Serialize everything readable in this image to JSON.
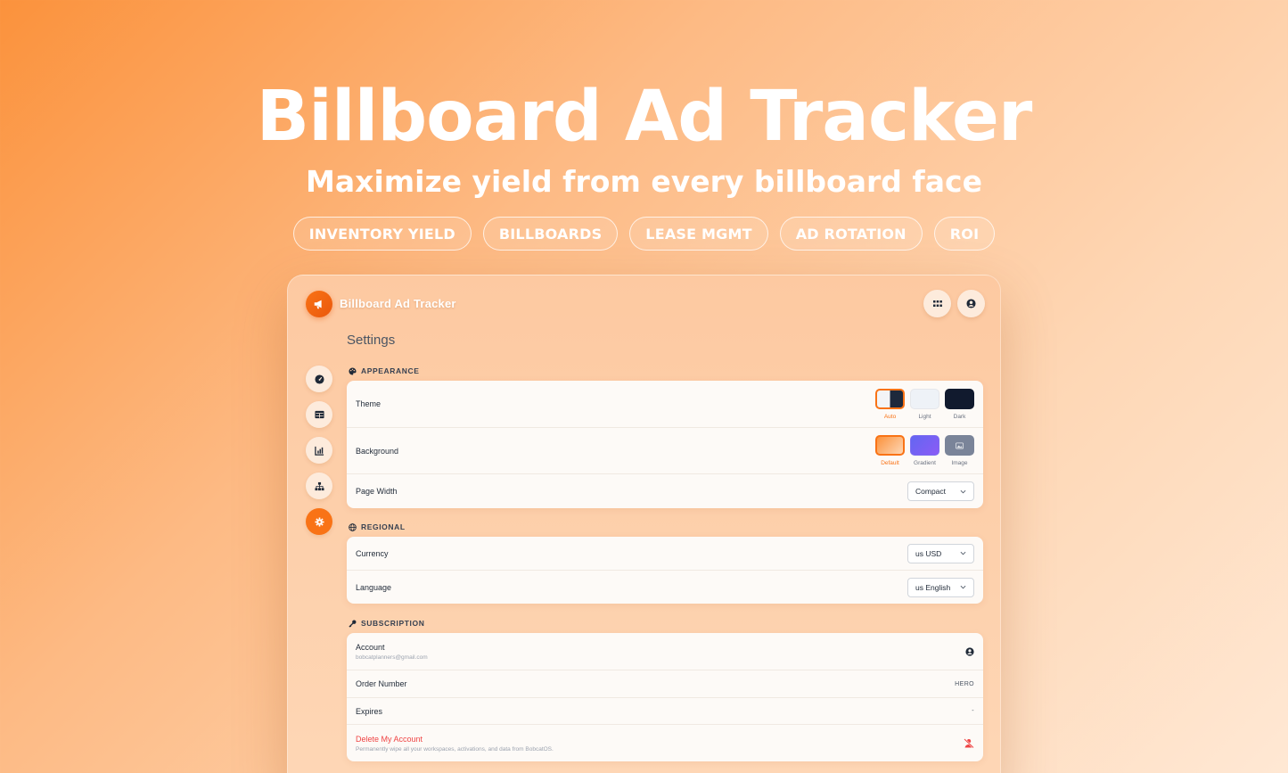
{
  "hero": {
    "title": "Billboard Ad Tracker",
    "subtitle": "Maximize yield from every billboard face",
    "tags": [
      "INVENTORY YIELD",
      "BILLBOARDS",
      "LEASE MGMT",
      "AD ROTATION",
      "ROI"
    ]
  },
  "app": {
    "title": "Billboard Ad Tracker",
    "page_title": "Settings",
    "accent": "#f97316"
  },
  "sidebar": {
    "items": [
      {
        "icon": "dashboard-gauge-icon"
      },
      {
        "icon": "table-icon"
      },
      {
        "icon": "bar-chart-icon"
      },
      {
        "icon": "hierarchy-icon"
      },
      {
        "icon": "gear-icon",
        "active": true
      }
    ]
  },
  "appearance": {
    "heading": "APPEARANCE",
    "theme_label": "Theme",
    "theme_options": [
      "Auto",
      "Light",
      "Dark"
    ],
    "theme_selected": "Auto",
    "background_label": "Background",
    "background_options": [
      "Default",
      "Gradient",
      "Image"
    ],
    "background_selected": "Default",
    "page_width_label": "Page Width",
    "page_width_value": "Compact"
  },
  "regional": {
    "heading": "REGIONAL",
    "currency_label": "Currency",
    "currency_value": "us USD",
    "language_label": "Language",
    "language_value": "us English"
  },
  "subscription": {
    "heading": "SUBSCRIPTION",
    "account_label": "Account",
    "account_email": "bobcatplanners@gmail.com",
    "order_label": "Order Number",
    "order_value": "HERO",
    "expires_label": "Expires",
    "expires_value": "-",
    "delete_label": "Delete My Account",
    "delete_desc": "Permanently wipe all your workspaces, activations, and data from BobcatOS."
  }
}
